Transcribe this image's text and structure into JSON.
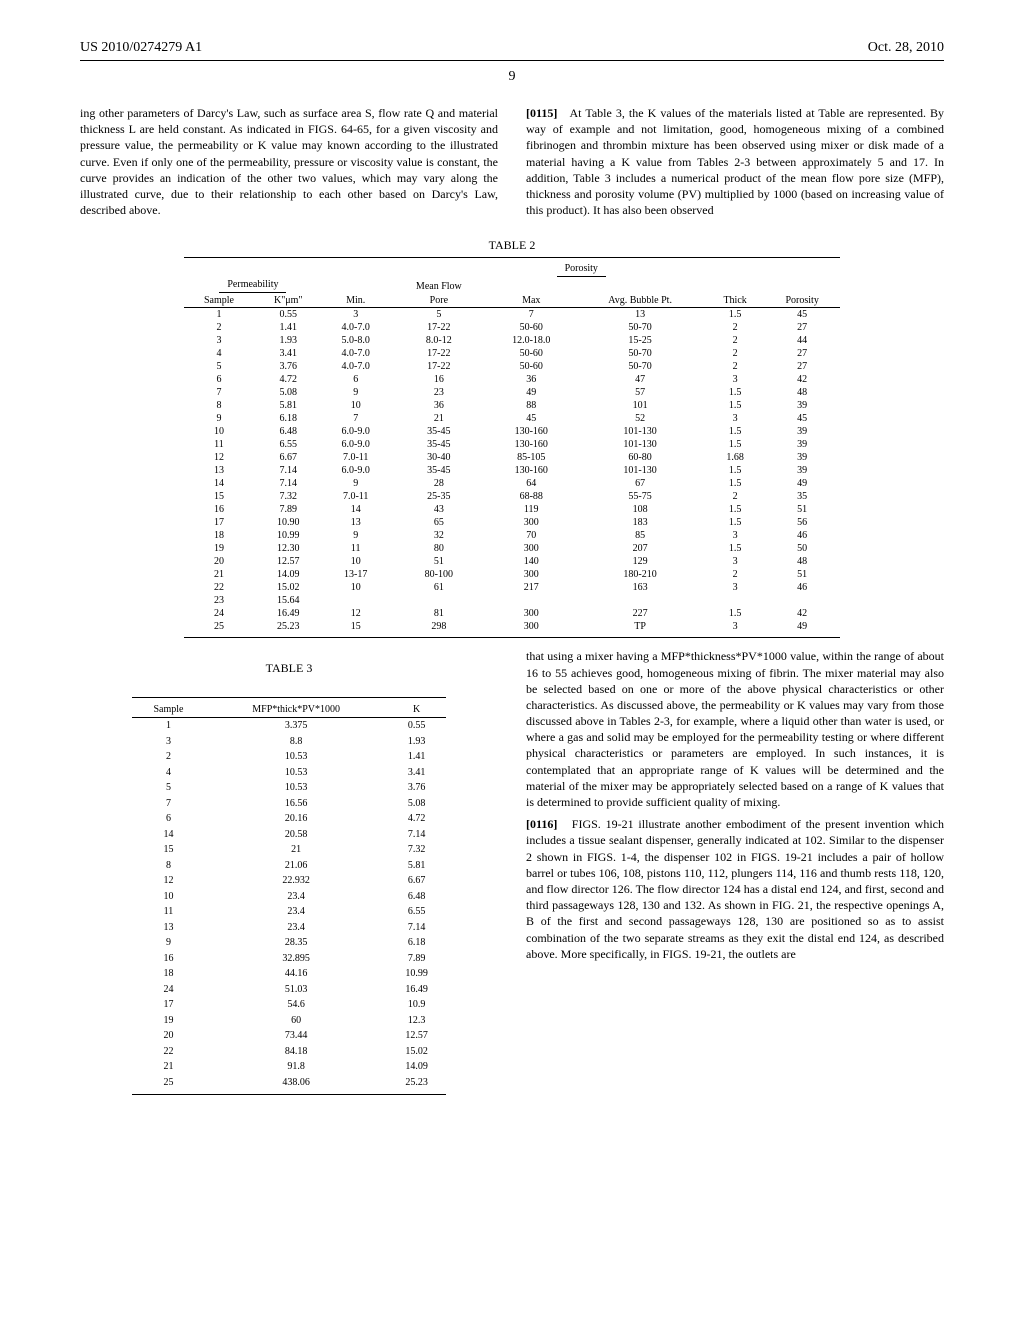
{
  "header": {
    "pub": "US 2010/0274279 A1",
    "date": "Oct. 28, 2010"
  },
  "page_number": "9",
  "left_col_top": "ing other parameters of Darcy's Law, such as surface area S, flow rate Q and material thickness L are held constant. As indicated in FIGS. 64-65, for a given viscosity and pressure value, the permeability or K value may known according to the illustrated curve. Even if only one of the permeability, pressure or viscosity value is constant, the curve provides an indication of the other two values, which may vary along the illustrated curve, due to their relationship to each other based on Darcy's Law, described above.",
  "right_col_top": {
    "num": "[0115]",
    "text": "At Table 3, the K values of the materials listed at Table are represented. By way of example and not limitation, good, homogeneous mixing of a combined fibrinogen and thrombin mixture has been observed using mixer or disk made of a material having a K value from Tables 2-3 between approximately 5 and 17. In addition, Table 3 includes a numerical product of the mean flow pore size (MFP), thickness and porosity volume (PV) multiplied by 1000 (based on increasing value of this product). It has also been observed"
  },
  "table2": {
    "title": "TABLE 2",
    "header_top_group": "Porosity",
    "header_sub1": "Permeability",
    "header_sub2": "Mean Flow",
    "cols": [
      "Sample",
      "K\"μm\"",
      "Min.",
      "Pore",
      "Max",
      "Avg. Bubble Pt.",
      "Thick",
      "Porosity"
    ],
    "rows": [
      [
        "1",
        "0.55",
        "3",
        "5",
        "7",
        "13",
        "1.5",
        "45"
      ],
      [
        "2",
        "1.41",
        "4.0-7.0",
        "17-22",
        "50-60",
        "50-70",
        "2",
        "27"
      ],
      [
        "3",
        "1.93",
        "5.0-8.0",
        "8.0-12",
        "12.0-18.0",
        "15-25",
        "2",
        "44"
      ],
      [
        "4",
        "3.41",
        "4.0-7.0",
        "17-22",
        "50-60",
        "50-70",
        "2",
        "27"
      ],
      [
        "5",
        "3.76",
        "4.0-7.0",
        "17-22",
        "50-60",
        "50-70",
        "2",
        "27"
      ],
      [
        "6",
        "4.72",
        "6",
        "16",
        "36",
        "47",
        "3",
        "42"
      ],
      [
        "7",
        "5.08",
        "9",
        "23",
        "49",
        "57",
        "1.5",
        "48"
      ],
      [
        "8",
        "5.81",
        "10",
        "36",
        "88",
        "101",
        "1.5",
        "39"
      ],
      [
        "9",
        "6.18",
        "7",
        "21",
        "45",
        "52",
        "3",
        "45"
      ],
      [
        "10",
        "6.48",
        "6.0-9.0",
        "35-45",
        "130-160",
        "101-130",
        "1.5",
        "39"
      ],
      [
        "11",
        "6.55",
        "6.0-9.0",
        "35-45",
        "130-160",
        "101-130",
        "1.5",
        "39"
      ],
      [
        "12",
        "6.67",
        "7.0-11",
        "30-40",
        "85-105",
        "60-80",
        "1.68",
        "39"
      ],
      [
        "13",
        "7.14",
        "6.0-9.0",
        "35-45",
        "130-160",
        "101-130",
        "1.5",
        "39"
      ],
      [
        "14",
        "7.14",
        "9",
        "28",
        "64",
        "67",
        "1.5",
        "49"
      ],
      [
        "15",
        "7.32",
        "7.0-11",
        "25-35",
        "68-88",
        "55-75",
        "2",
        "35"
      ],
      [
        "16",
        "7.89",
        "14",
        "43",
        "119",
        "108",
        "1.5",
        "51"
      ],
      [
        "17",
        "10.90",
        "13",
        "65",
        "300",
        "183",
        "1.5",
        "56"
      ],
      [
        "18",
        "10.99",
        "9",
        "32",
        "70",
        "85",
        "3",
        "46"
      ],
      [
        "19",
        "12.30",
        "11",
        "80",
        "300",
        "207",
        "1.5",
        "50"
      ],
      [
        "20",
        "12.57",
        "10",
        "51",
        "140",
        "129",
        "3",
        "48"
      ],
      [
        "21",
        "14.09",
        "13-17",
        "80-100",
        "300",
        "180-210",
        "2",
        "51"
      ],
      [
        "22",
        "15.02",
        "10",
        "61",
        "217",
        "163",
        "3",
        "46"
      ],
      [
        "23",
        "15.64",
        "",
        "",
        "",
        "",
        "",
        ""
      ],
      [
        "24",
        "16.49",
        "12",
        "81",
        "300",
        "227",
        "1.5",
        "42"
      ],
      [
        "25",
        "25.23",
        "15",
        "298",
        "300",
        "TP",
        "3",
        "49"
      ]
    ]
  },
  "table3": {
    "title": "TABLE 3",
    "cols": [
      "Sample",
      "MFP*thick*PV*1000",
      "K"
    ],
    "rows": [
      [
        "1",
        "3.375",
        "0.55"
      ],
      [
        "3",
        "8.8",
        "1.93"
      ],
      [
        "2",
        "10.53",
        "1.41"
      ],
      [
        "4",
        "10.53",
        "3.41"
      ],
      [
        "5",
        "10.53",
        "3.76"
      ],
      [
        "7",
        "16.56",
        "5.08"
      ],
      [
        "6",
        "20.16",
        "4.72"
      ],
      [
        "14",
        "20.58",
        "7.14"
      ],
      [
        "15",
        "21",
        "7.32"
      ],
      [
        "8",
        "21.06",
        "5.81"
      ],
      [
        "12",
        "22.932",
        "6.67"
      ],
      [
        "10",
        "23.4",
        "6.48"
      ],
      [
        "11",
        "23.4",
        "6.55"
      ],
      [
        "13",
        "23.4",
        "7.14"
      ],
      [
        "9",
        "28.35",
        "6.18"
      ],
      [
        "16",
        "32.895",
        "7.89"
      ],
      [
        "18",
        "44.16",
        "10.99"
      ],
      [
        "24",
        "51.03",
        "16.49"
      ],
      [
        "17",
        "54.6",
        "10.9"
      ],
      [
        "19",
        "60",
        "12.3"
      ],
      [
        "20",
        "73.44",
        "12.57"
      ],
      [
        "22",
        "84.18",
        "15.02"
      ],
      [
        "21",
        "91.8",
        "14.09"
      ],
      [
        "25",
        "438.06",
        "25.23"
      ]
    ]
  },
  "right_col_bottom1": "that using a mixer having a MFP*thickness*PV*1000 value, within the range of about 16 to 55 achieves good, homogeneous mixing of fibrin. The mixer material may also be selected based on one or more of the above physical characteristics or other characteristics. As discussed above, the permeability or K values may vary from those discussed above in Tables 2-3, for example, where a liquid other than water is used, or where a gas and solid may be employed for the permeability testing or where different physical characteristics or parameters are employed. In such instances, it is contemplated that an appropriate range of K values will be determined and the material of the mixer may be appropriately selected based on a range of K values that is determined to provide sufficient quality of mixing.",
  "right_col_bottom2": {
    "num": "[0116]",
    "text": "FIGS. 19-21 illustrate another embodiment of the present invention which includes a tissue sealant dispenser, generally indicated at 102. Similar to the dispenser 2 shown in FIGS. 1-4, the dispenser 102 in FIGS. 19-21 includes a pair of hollow barrel or tubes 106, 108, pistons 110, 112, plungers 114, 116 and thumb rests 118, 120, and flow director 126. The flow director 124 has a distal end 124, and first, second and third passageways 128, 130 and 132. As shown in FIG. 21, the respective openings A, B of the first and second passageways 128, 130 are positioned so as to assist combination of the two separate streams as they exit the distal end 124, as described above. More specifically, in FIGS. 19-21, the outlets are"
  },
  "chart_data": [
    {
      "type": "table",
      "title": "TABLE 2 — Porosity",
      "columns": [
        "Sample",
        "K\"μm\"",
        "Min.",
        "Pore (Mean Flow)",
        "Max",
        "Avg. Bubble Pt.",
        "Thick",
        "Porosity"
      ],
      "rows": [
        [
          1,
          0.55,
          3,
          5,
          7,
          13,
          1.5,
          45
        ],
        [
          2,
          1.41,
          "4.0-7.0",
          "17-22",
          "50-60",
          "50-70",
          2,
          27
        ],
        [
          3,
          1.93,
          "5.0-8.0",
          "8.0-12",
          "12.0-18.0",
          "15-25",
          2,
          44
        ],
        [
          4,
          3.41,
          "4.0-7.0",
          "17-22",
          "50-60",
          "50-70",
          2,
          27
        ],
        [
          5,
          3.76,
          "4.0-7.0",
          "17-22",
          "50-60",
          "50-70",
          2,
          27
        ],
        [
          6,
          4.72,
          6,
          16,
          36,
          47,
          3,
          42
        ],
        [
          7,
          5.08,
          9,
          23,
          49,
          57,
          1.5,
          48
        ],
        [
          8,
          5.81,
          10,
          36,
          88,
          101,
          1.5,
          39
        ],
        [
          9,
          6.18,
          7,
          21,
          45,
          52,
          3,
          45
        ],
        [
          10,
          6.48,
          "6.0-9.0",
          "35-45",
          "130-160",
          "101-130",
          1.5,
          39
        ],
        [
          11,
          6.55,
          "6.0-9.0",
          "35-45",
          "130-160",
          "101-130",
          1.5,
          39
        ],
        [
          12,
          6.67,
          "7.0-11",
          "30-40",
          "85-105",
          "60-80",
          1.68,
          39
        ],
        [
          13,
          7.14,
          "6.0-9.0",
          "35-45",
          "130-160",
          "101-130",
          1.5,
          39
        ],
        [
          14,
          7.14,
          9,
          28,
          64,
          67,
          1.5,
          49
        ],
        [
          15,
          7.32,
          "7.0-11",
          "25-35",
          "68-88",
          "55-75",
          2,
          35
        ],
        [
          16,
          7.89,
          14,
          43,
          119,
          108,
          1.5,
          51
        ],
        [
          17,
          10.9,
          13,
          65,
          300,
          183,
          1.5,
          56
        ],
        [
          18,
          10.99,
          9,
          32,
          70,
          85,
          3,
          46
        ],
        [
          19,
          12.3,
          11,
          80,
          300,
          207,
          1.5,
          50
        ],
        [
          20,
          12.57,
          10,
          51,
          140,
          129,
          3,
          48
        ],
        [
          21,
          14.09,
          "13-17",
          "80-100",
          300,
          "180-210",
          2,
          51
        ],
        [
          22,
          15.02,
          10,
          61,
          217,
          163,
          3,
          46
        ],
        [
          23,
          15.64,
          null,
          null,
          null,
          null,
          null,
          null
        ],
        [
          24,
          16.49,
          12,
          81,
          300,
          227,
          1.5,
          42
        ],
        [
          25,
          25.23,
          15,
          298,
          300,
          "TP",
          3,
          49
        ]
      ]
    },
    {
      "type": "table",
      "title": "TABLE 3",
      "columns": [
        "Sample",
        "MFP*thick*PV*1000",
        "K"
      ],
      "rows": [
        [
          1,
          3.375,
          0.55
        ],
        [
          3,
          8.8,
          1.93
        ],
        [
          2,
          10.53,
          1.41
        ],
        [
          4,
          10.53,
          3.41
        ],
        [
          5,
          10.53,
          3.76
        ],
        [
          7,
          16.56,
          5.08
        ],
        [
          6,
          20.16,
          4.72
        ],
        [
          14,
          20.58,
          7.14
        ],
        [
          15,
          21,
          7.32
        ],
        [
          8,
          21.06,
          5.81
        ],
        [
          12,
          22.932,
          6.67
        ],
        [
          10,
          23.4,
          6.48
        ],
        [
          11,
          23.4,
          6.55
        ],
        [
          13,
          23.4,
          7.14
        ],
        [
          9,
          28.35,
          6.18
        ],
        [
          16,
          32.895,
          7.89
        ],
        [
          18,
          44.16,
          10.99
        ],
        [
          24,
          51.03,
          16.49
        ],
        [
          17,
          54.6,
          10.9
        ],
        [
          19,
          60,
          12.3
        ],
        [
          20,
          73.44,
          12.57
        ],
        [
          22,
          84.18,
          15.02
        ],
        [
          21,
          91.8,
          14.09
        ],
        [
          25,
          438.06,
          25.23
        ]
      ]
    }
  ]
}
